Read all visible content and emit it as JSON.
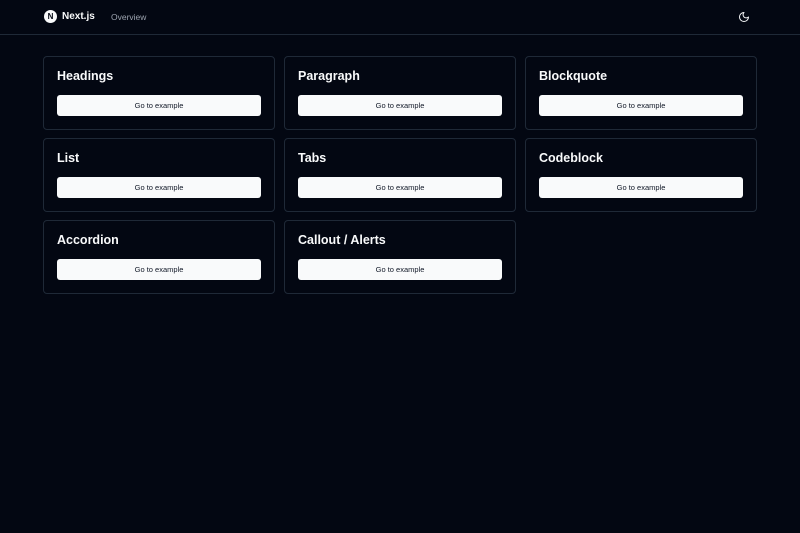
{
  "header": {
    "logo_letter": "N",
    "logo_text": "Next.js",
    "nav_overview": "Overview",
    "theme_icon": "moon-icon"
  },
  "cards": [
    {
      "title": "Headings",
      "button": "Go to example"
    },
    {
      "title": "Paragraph",
      "button": "Go to example"
    },
    {
      "title": "Blockquote",
      "button": "Go to example"
    },
    {
      "title": "List",
      "button": "Go to example"
    },
    {
      "title": "Tabs",
      "button": "Go to example"
    },
    {
      "title": "Codeblock",
      "button": "Go to example"
    },
    {
      "title": "Accordion",
      "button": "Go to example"
    },
    {
      "title": "Callout / Alerts",
      "button": "Go to example"
    }
  ],
  "colors": {
    "background": "#030712",
    "border": "#1f2937",
    "text": "#f9fafb",
    "muted": "#9ca3af",
    "button_bg": "#f9fafb",
    "button_text": "#111827"
  }
}
